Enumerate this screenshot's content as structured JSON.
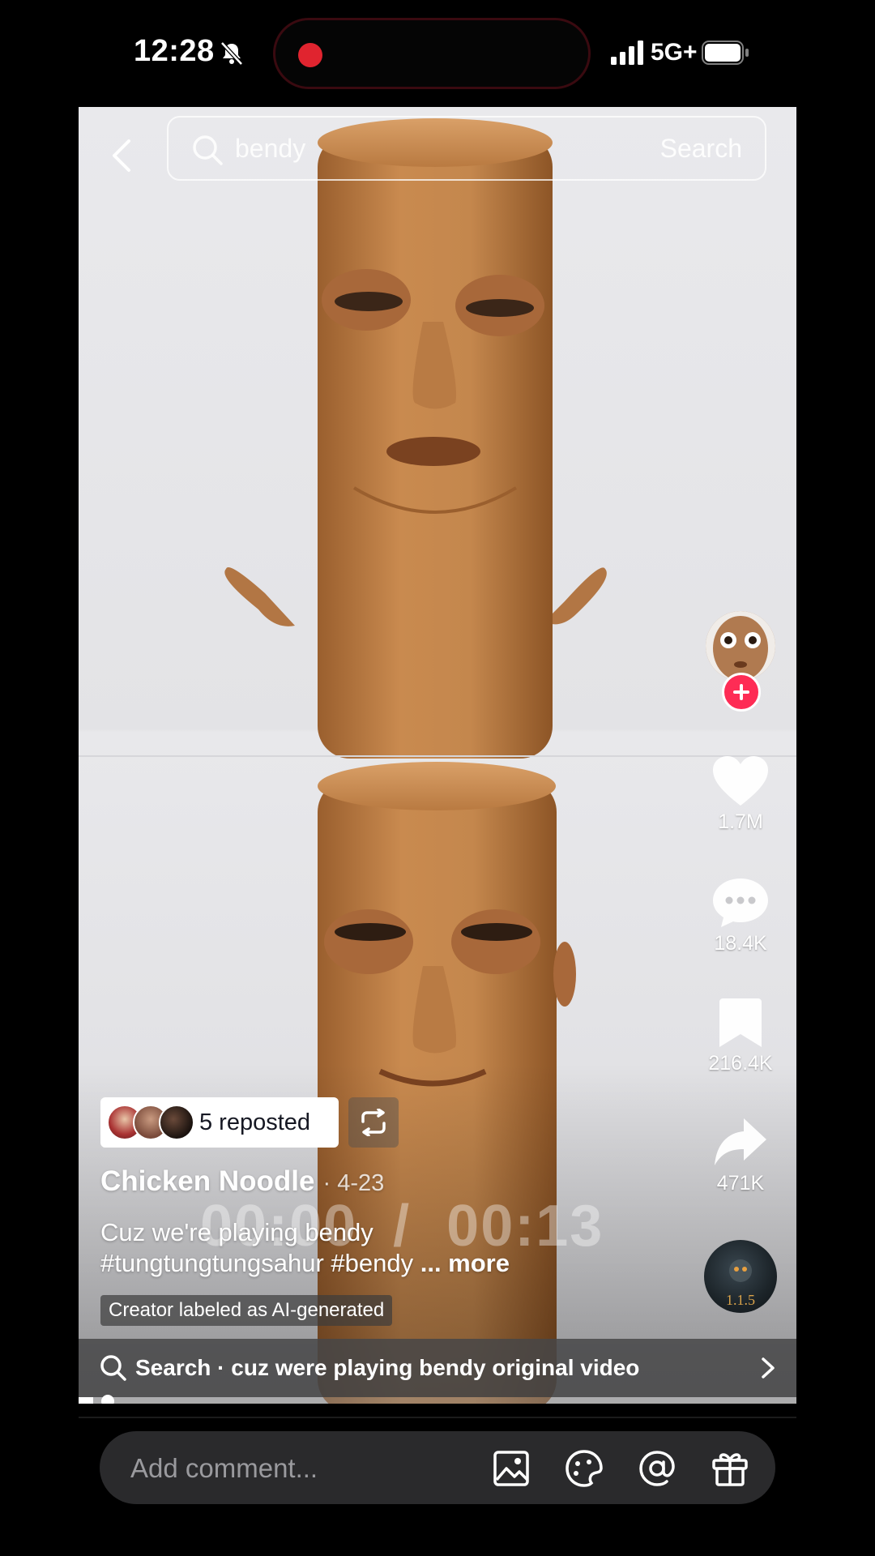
{
  "status_bar": {
    "time": "12:28",
    "network": "5G+",
    "icons": [
      "bell-off-icon",
      "recording-dot-icon",
      "signal-icon",
      "battery-icon"
    ]
  },
  "search": {
    "query": "bendy",
    "submit_label": "Search"
  },
  "rail": {
    "likes": "1.7M",
    "comments": "18.4K",
    "saves": "216.4K",
    "shares": "471K",
    "disc_text": "1.1.5"
  },
  "repost": {
    "label": "5 reposted"
  },
  "post": {
    "author": "Chicken Noodle",
    "date": "· 4-23",
    "caption_line1": "Cuz we're playing bendy",
    "caption_line2": "#tungtungtungsahur #bendy",
    "more": "... more",
    "ai_label": "Creator labeled as AI-generated"
  },
  "player": {
    "current_time": "00:00",
    "separator": "/",
    "duration": "00:13",
    "progress_fraction": 0.02
  },
  "suggestion": {
    "text": "Search · cuz were playing bendy original video"
  },
  "comment_bar": {
    "placeholder": "Add comment...",
    "icons": [
      "image-icon",
      "sticker-icon",
      "mention-icon",
      "gift-icon"
    ]
  },
  "colors": {
    "accent": "#fe2c55",
    "background": "#000000",
    "comment_bar": "#2a2a2c"
  }
}
